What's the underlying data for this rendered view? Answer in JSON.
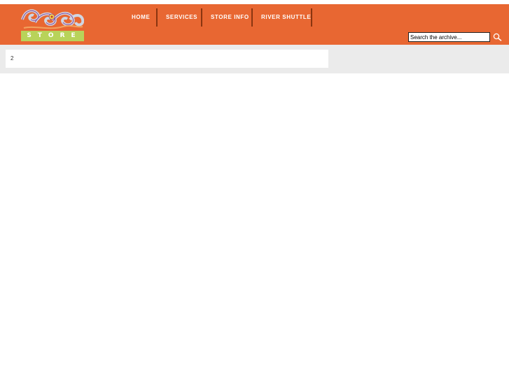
{
  "logo": {
    "word": "STORE",
    "colors": {
      "bar": "#b8d35a",
      "header": "#e86732"
    }
  },
  "nav": {
    "items": [
      {
        "label": "HOME"
      },
      {
        "label": "SERVICES"
      },
      {
        "label": "STORE INFO"
      },
      {
        "label": "RIVER SHUTTLE"
      }
    ]
  },
  "search": {
    "value": "Search the archive...",
    "icon": "search-icon"
  },
  "main": {
    "content": "2"
  }
}
